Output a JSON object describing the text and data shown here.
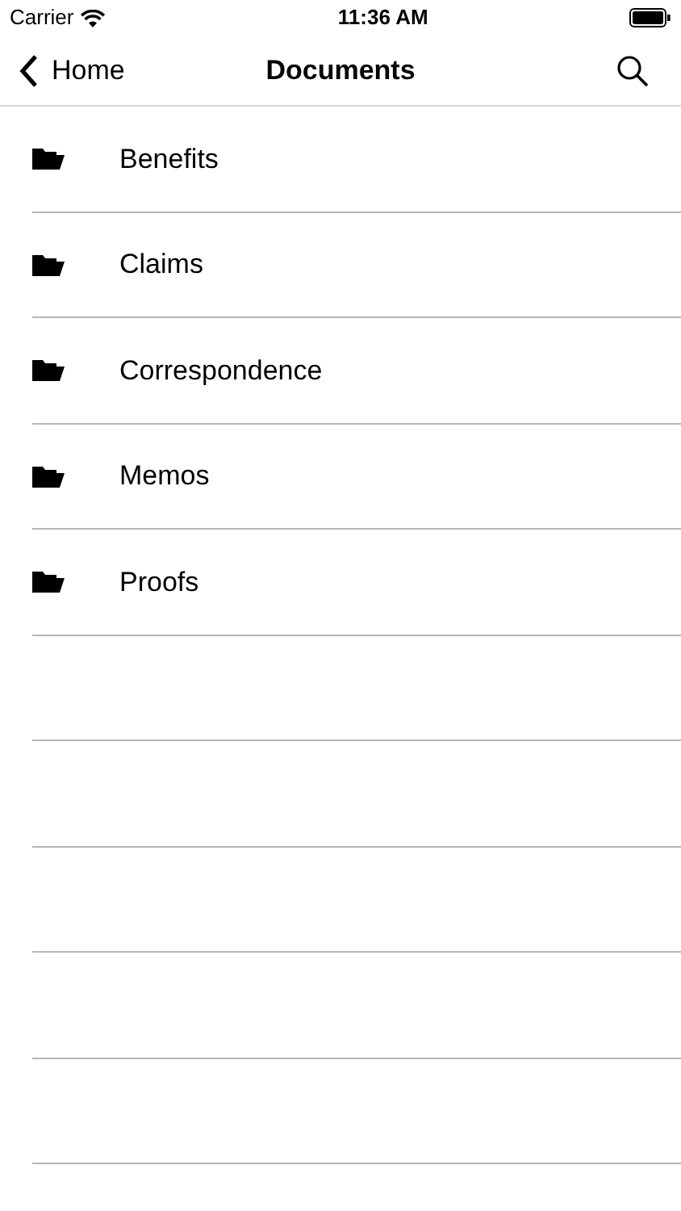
{
  "status_bar": {
    "carrier": "Carrier",
    "time": "11:36 AM"
  },
  "nav": {
    "back": "Home",
    "title": "Documents"
  },
  "folders": [
    {
      "name": "Benefits"
    },
    {
      "name": "Claims"
    },
    {
      "name": "Correspondence"
    },
    {
      "name": "Memos"
    },
    {
      "name": "Proofs"
    }
  ]
}
